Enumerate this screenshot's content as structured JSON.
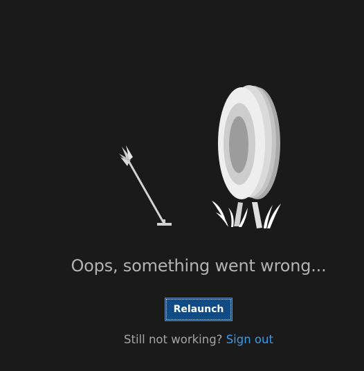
{
  "error": {
    "message": "Oops, something went wrong...",
    "relaunch_label": "Relaunch",
    "footer_prefix": "Still not working?",
    "sign_out_label": "Sign out"
  },
  "colors": {
    "background": "#1b1a1a",
    "button": "#0f4c86",
    "link": "#3d9ae8",
    "message_text": "#b3b3b3"
  },
  "icons": [
    "arrow-icon",
    "target-icon",
    "grass-icon"
  ]
}
